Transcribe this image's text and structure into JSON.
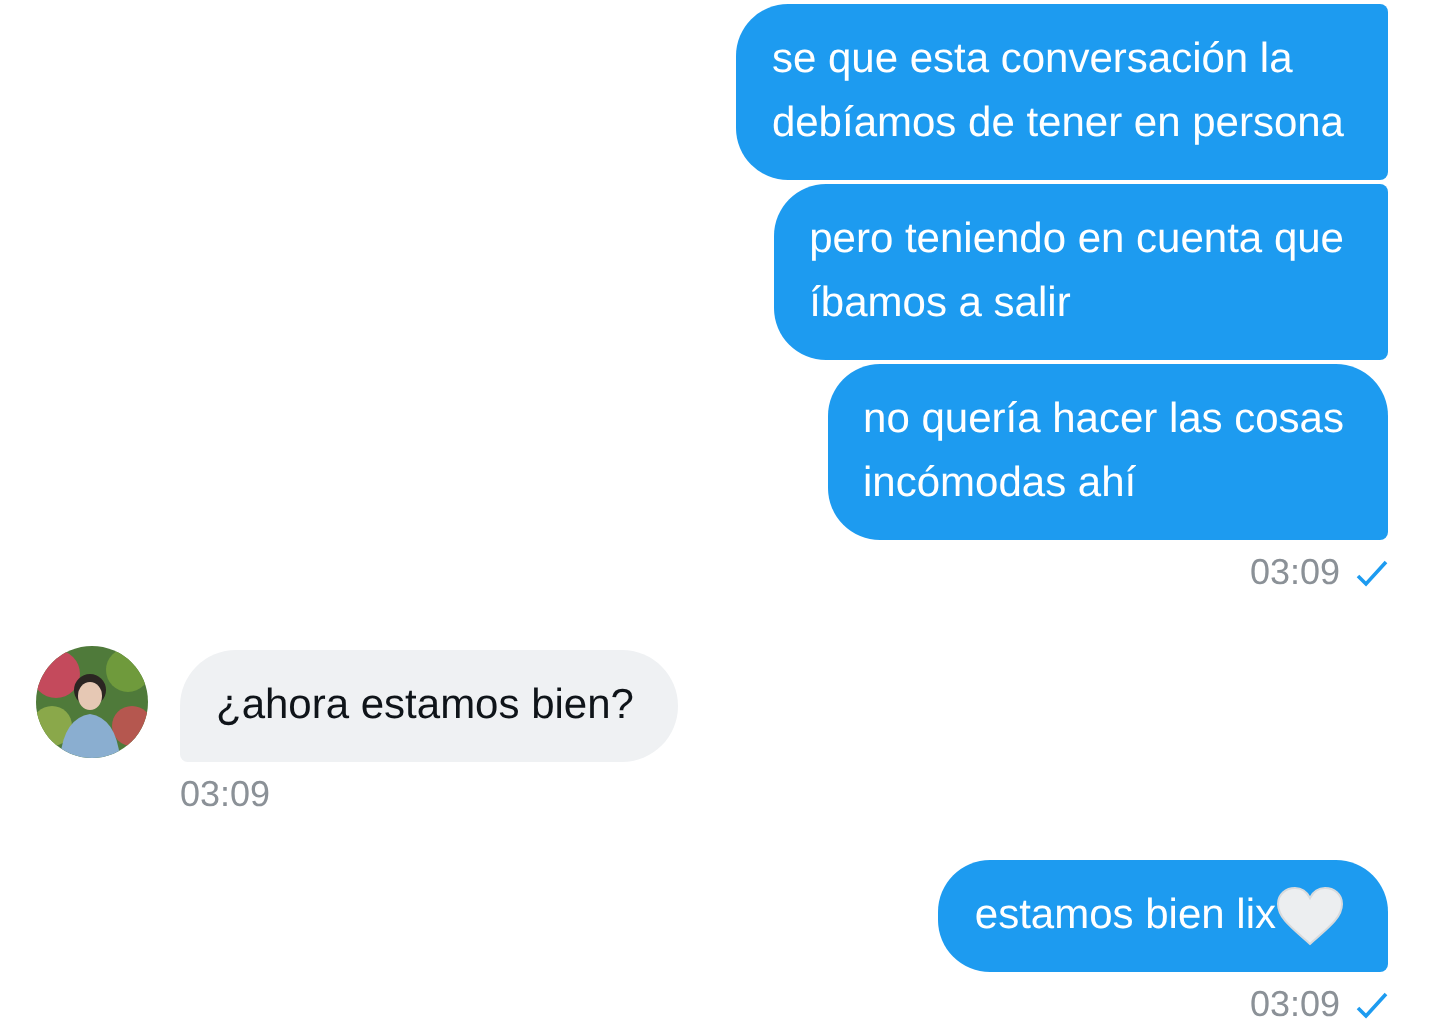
{
  "groups": [
    {
      "kind": "sent",
      "bubbles": [
        {
          "lines": [
            "se que esta conversación la",
            "debíamos de tener en persona"
          ],
          "heart": false
        },
        {
          "lines": [
            "pero teniendo en cuenta que",
            "íbamos a salir"
          ],
          "heart": false
        },
        {
          "lines": [
            "no quería hacer las cosas",
            "incómodas ahí"
          ],
          "heart": false
        }
      ],
      "time": "03:09",
      "checked": true
    },
    {
      "kind": "received",
      "bubbles": [
        {
          "lines": [
            "¿ahora estamos bien?"
          ],
          "heart": false
        }
      ],
      "time": "03:09",
      "checked": false
    },
    {
      "kind": "sent",
      "bubbles": [
        {
          "lines": [
            "estamos bien lix"
          ],
          "heart": true
        }
      ],
      "time": "03:09",
      "checked": true
    }
  ]
}
